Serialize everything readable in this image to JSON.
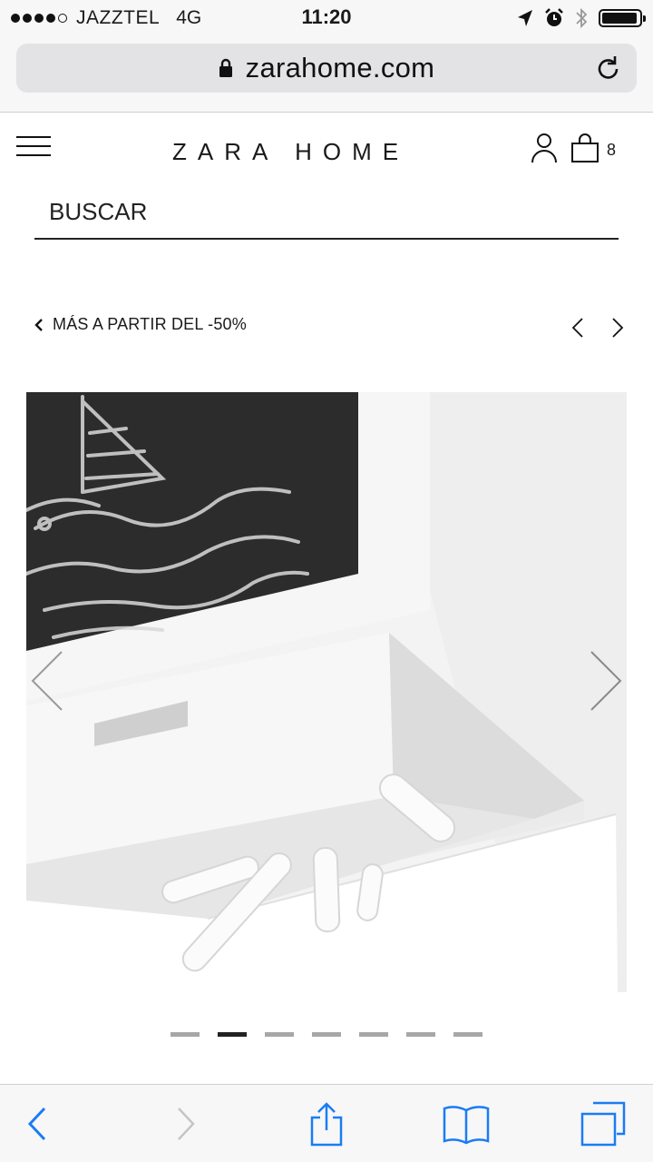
{
  "status_bar": {
    "carrier": "JAZZTEL",
    "network": "4G",
    "time": "11:20",
    "signal_bars_filled": 4,
    "signal_bars_total": 5,
    "battery_level": 0.95,
    "icons": [
      "location-icon",
      "alarm-icon",
      "bluetooth-icon",
      "battery-icon"
    ]
  },
  "browser": {
    "url": "zarahome.com",
    "secure": true,
    "accent_color": "#1a7cf5",
    "toolbar_icons": [
      "back-icon",
      "forward-icon",
      "share-icon",
      "bookmarks-icon",
      "tabs-icon"
    ]
  },
  "header": {
    "logo": "ZARA HOME",
    "cart_count": "8",
    "icons": [
      "menu-icon",
      "user-icon",
      "bag-icon"
    ]
  },
  "search": {
    "label": "BUSCAR"
  },
  "breadcrumb": {
    "label": "MÁS A PARTIR DEL -50%"
  },
  "product": {
    "image_subject": "white wooden box with chalkboard lid and chalk sticks",
    "gallery_total": 7,
    "gallery_active_index": 1
  }
}
